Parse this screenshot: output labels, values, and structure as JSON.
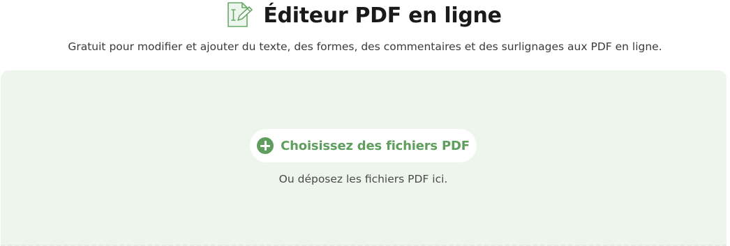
{
  "header": {
    "title": "Éditeur PDF en ligne",
    "icon": "pdf-edit-icon",
    "subtitle": "Gratuit pour modifier et ajouter du texte, des formes, des commentaires et des surlignages aux PDF en ligne."
  },
  "upload": {
    "choose_label": "Choisissez des fichiers PDF",
    "choose_icon": "plus-circle-icon",
    "drop_hint": "Ou déposez les fichiers PDF ici."
  },
  "colors": {
    "accent": "#5f9e5e",
    "dropzone_bg": "#eef5ed",
    "title_text": "#1a1a1a"
  }
}
